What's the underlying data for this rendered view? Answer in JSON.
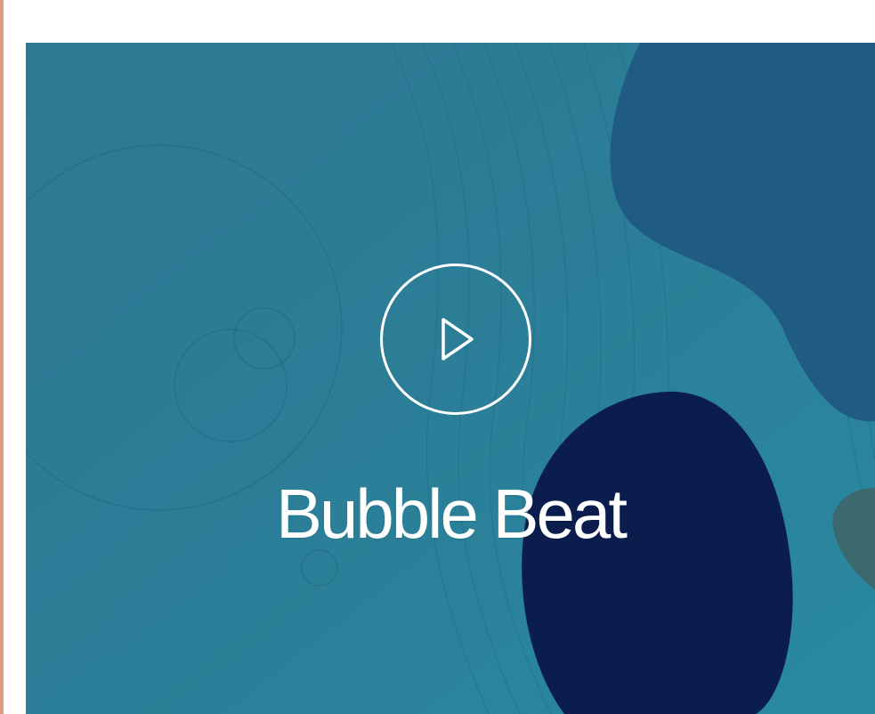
{
  "video": {
    "title": "Bubble Beat"
  },
  "icons": {
    "play": "play-icon"
  },
  "colors": {
    "page_background": "#ffffff",
    "accent_line": "#d57a5a",
    "card_teal": "#2b7e97",
    "blob_blue": "#1f5b83",
    "blob_navy": "#0b1d4d",
    "blob_green": "#3c6970",
    "text_white": "#ffffff"
  }
}
